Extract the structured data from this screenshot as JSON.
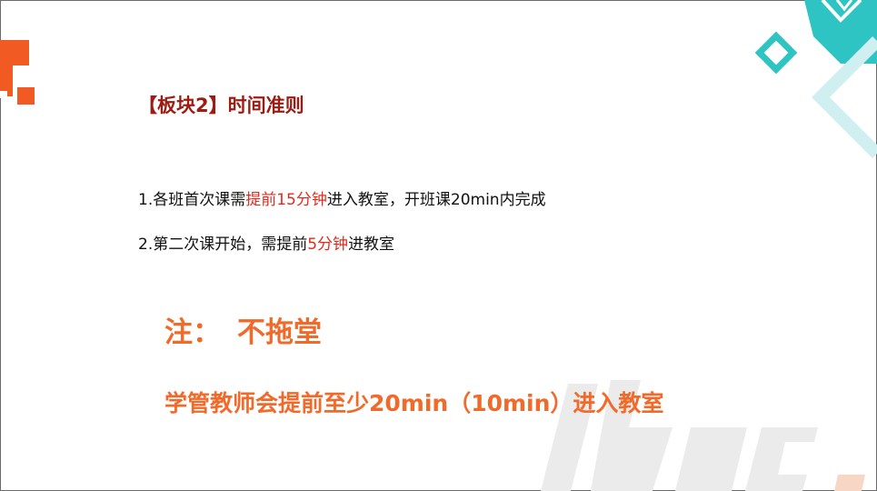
{
  "slide": {
    "heading": "【板块2】时间准则",
    "rules": [
      {
        "parts": [
          "1.各班首次课需",
          "提前15分钟",
          "进入教室，开班课20min内完成"
        ]
      },
      {
        "parts": [
          "2.第二次课开始，需提前",
          "5分钟",
          "进教室"
        ]
      }
    ],
    "note": {
      "label": "注：",
      "title": "不拖堂",
      "body": "学管教师会提前至少20min（10min）进入教室"
    },
    "watermark_text": "iboc."
  },
  "colors": {
    "heading": "#9e1b12",
    "highlight": "#e8281a",
    "note": "#f26a2a",
    "accent_orange": "#f25a24",
    "accent_teal": "#2ec4c4"
  },
  "decorations": {
    "top_left": "orange-bracket-logo",
    "top_right": "teal-diamond-pattern",
    "bottom_right": "iboc-watermark-logo"
  }
}
